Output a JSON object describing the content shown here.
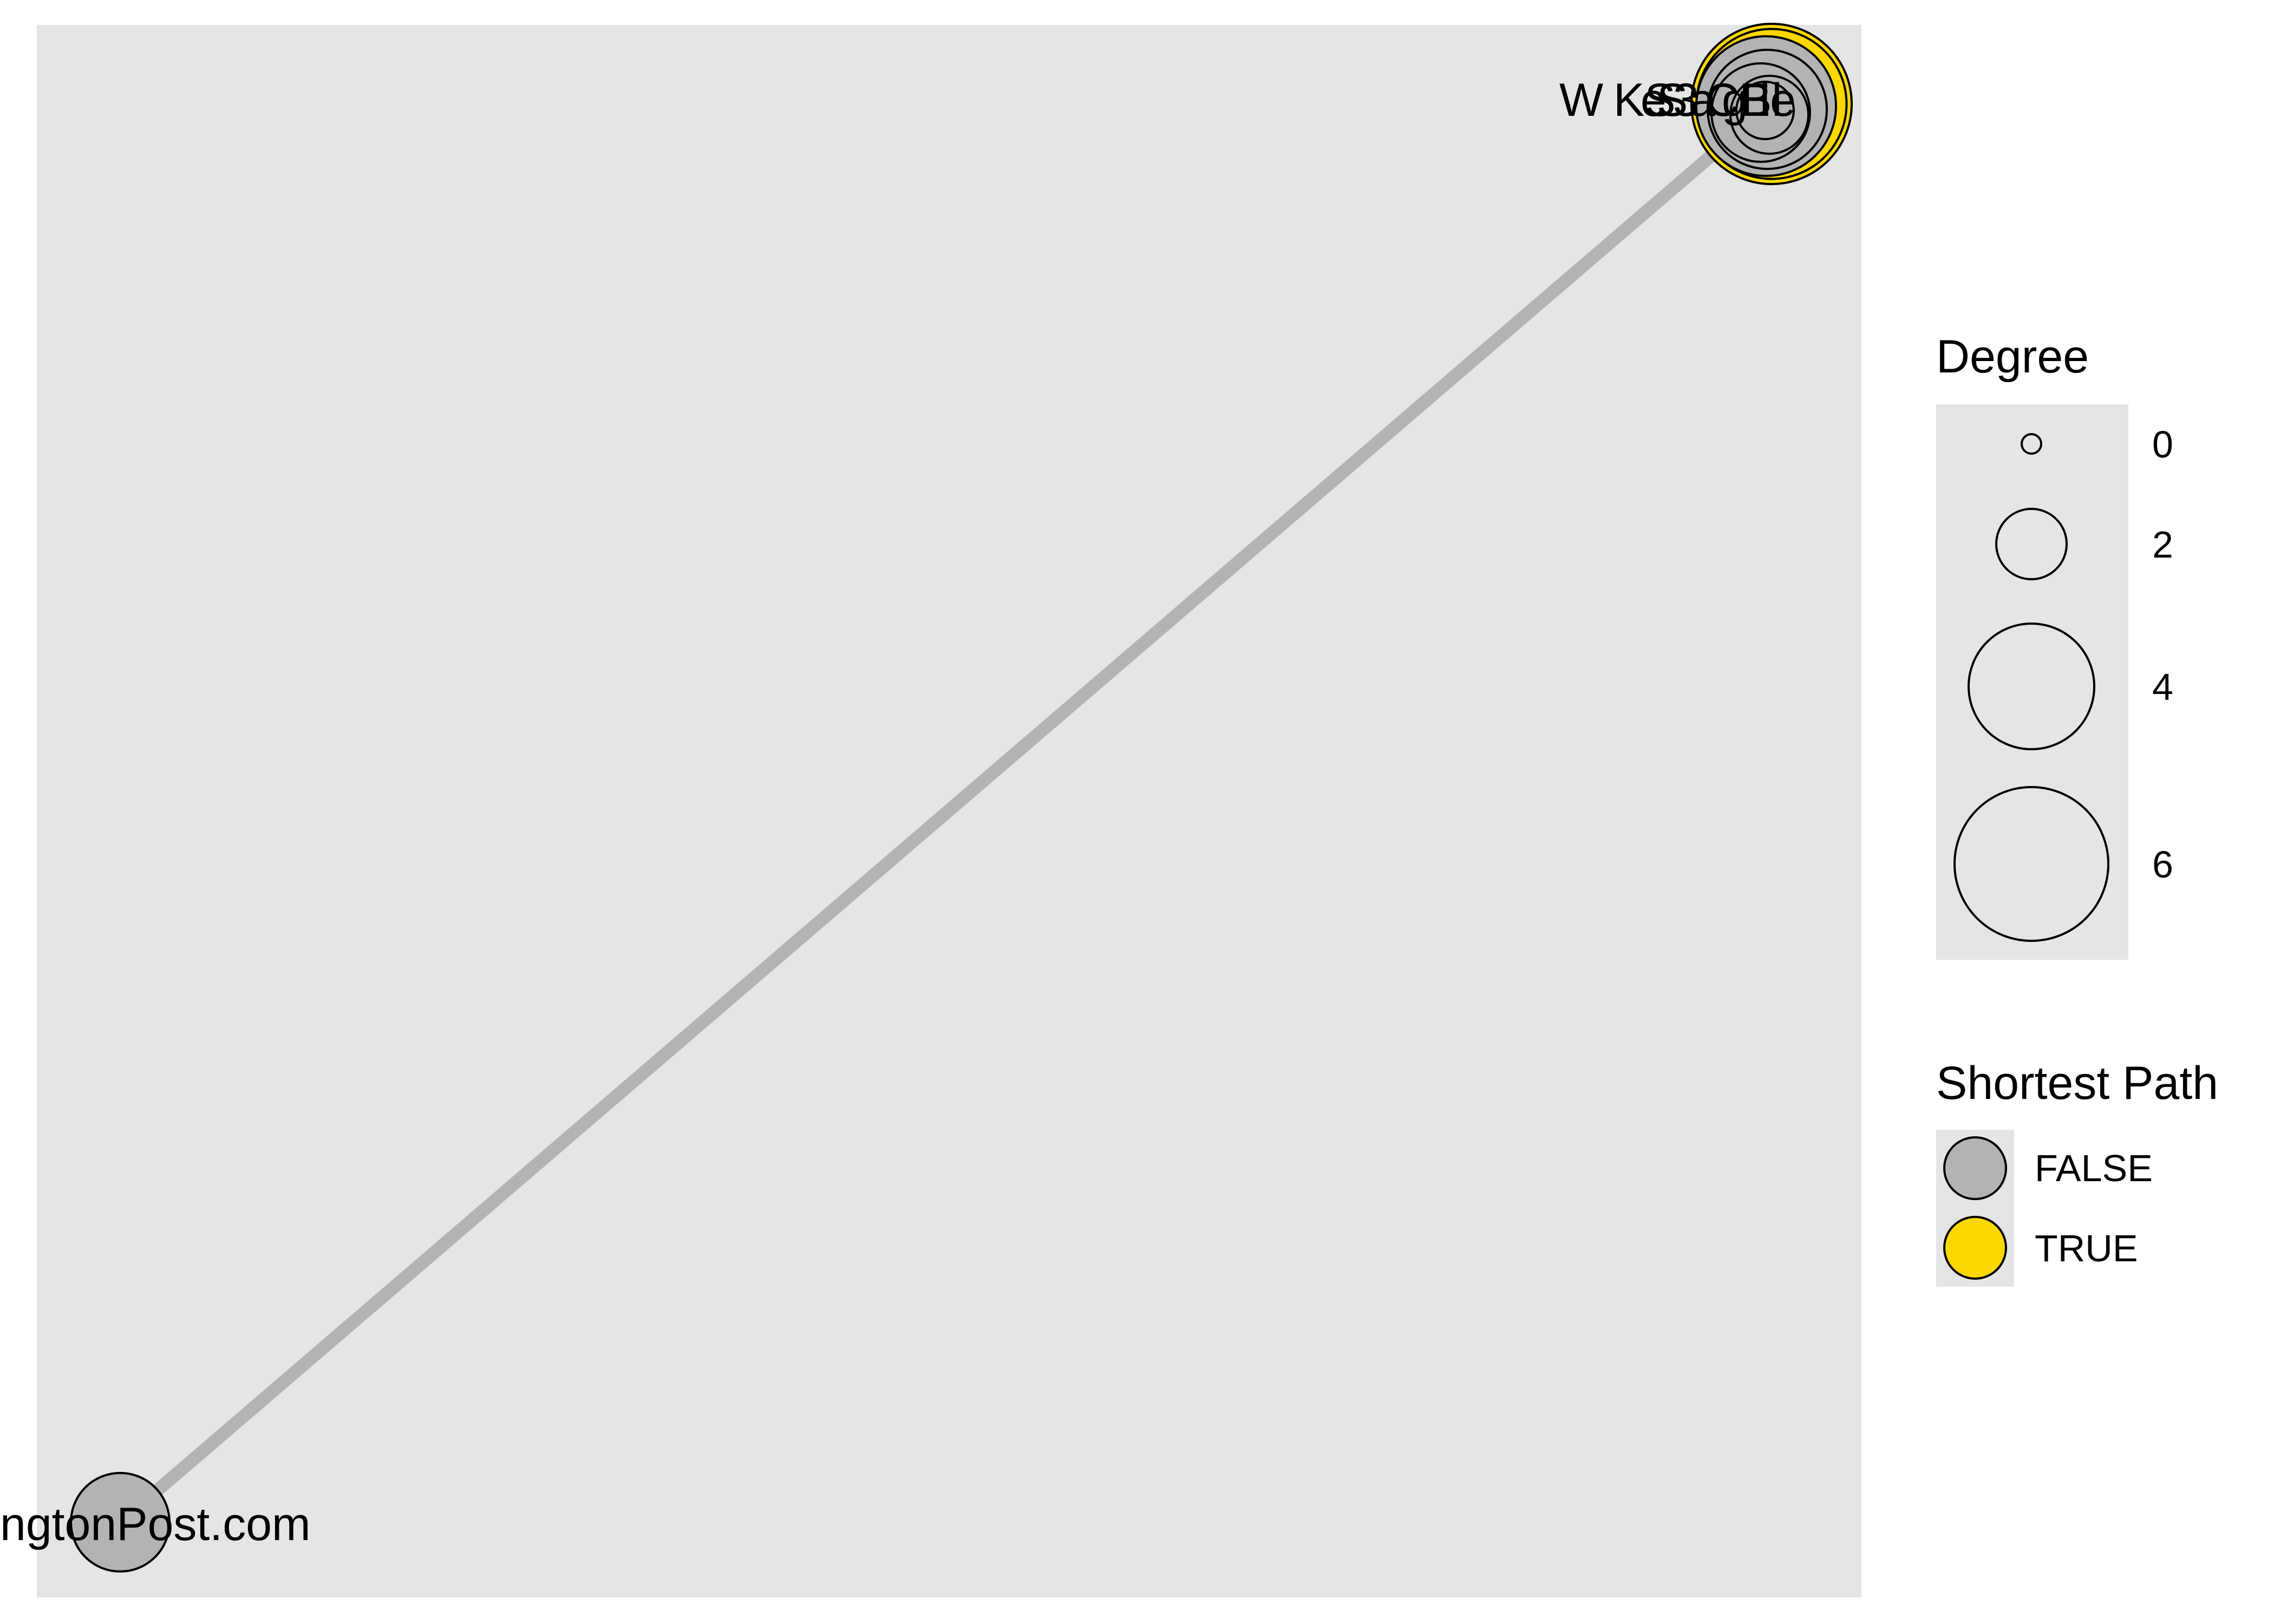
{
  "colors": {
    "panel_bg": "#e5e5e5",
    "edge": "#b3b3b3",
    "node_false": "#b3b3b3",
    "node_true": "#ffd700",
    "stroke": "#000000"
  },
  "diagram": {
    "type": "network",
    "edges": [
      {
        "from": "HuffingtonPost.com",
        "to": "cluster",
        "highlight": false
      }
    ],
    "nodes": [
      {
        "id": "huffpost",
        "label": "ngtonPost.com",
        "on_shortest_path": false,
        "degree": 4
      },
      {
        "id": "cluster-true-outer",
        "label": "",
        "on_shortest_path": true,
        "degree": 7
      },
      {
        "id": "cluster-true-2",
        "label": "",
        "on_shortest_path": true,
        "degree": 6.5
      },
      {
        "id": "cluster-false-1",
        "label": "",
        "on_shortest_path": false,
        "degree": 6
      },
      {
        "id": "cluster-false-2",
        "label": "",
        "on_shortest_path": false,
        "degree": 5
      },
      {
        "id": "cluster-false-3",
        "label": "",
        "on_shortest_path": false,
        "degree": 4
      },
      {
        "id": "cluster-false-4",
        "label": "",
        "on_shortest_path": false,
        "degree": 3
      },
      {
        "id": "cluster-false-5",
        "label": "",
        "on_shortest_path": false,
        "degree": 2
      }
    ],
    "cluster_label_fragments": [
      "W",
      "KS",
      "e",
      "S",
      "3",
      "a",
      "CE",
      "g",
      "Bl",
      "le"
    ]
  },
  "legend": {
    "degree": {
      "title": "Degree",
      "entries": [
        {
          "label": "0",
          "value": 0
        },
        {
          "label": "2",
          "value": 2
        },
        {
          "label": "4",
          "value": 4
        },
        {
          "label": "6",
          "value": 6
        }
      ]
    },
    "shortest_path": {
      "title": "Shortest Path",
      "entries": [
        {
          "label": "FALSE",
          "color": "#b3b3b3"
        },
        {
          "label": "TRUE",
          "color": "#ffd700"
        }
      ]
    }
  }
}
